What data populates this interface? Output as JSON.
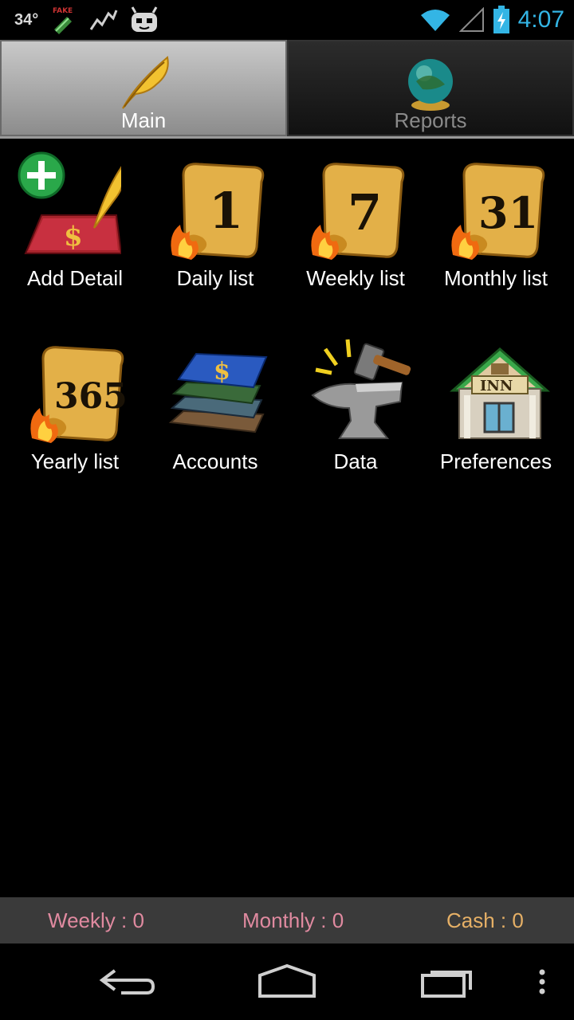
{
  "status_bar": {
    "temperature": "34°",
    "time": "4:07",
    "icons": [
      "fake-gps-icon",
      "activity-graph-icon",
      "android-icon",
      "wifi-icon",
      "signal-icon",
      "battery-charging-icon"
    ]
  },
  "tabs": [
    {
      "label": "Main",
      "icon": "quill-icon",
      "selected": true
    },
    {
      "label": "Reports",
      "icon": "globe-icon",
      "selected": false
    }
  ],
  "grid": [
    {
      "label": "Add Detail",
      "icon": "add-detail-icon"
    },
    {
      "label": "Daily list",
      "icon": "scroll-1-icon"
    },
    {
      "label": "Weekly list",
      "icon": "scroll-7-icon"
    },
    {
      "label": "Monthly list",
      "icon": "scroll-31-icon"
    },
    {
      "label": "Yearly list",
      "icon": "scroll-365-icon"
    },
    {
      "label": "Accounts",
      "icon": "books-icon"
    },
    {
      "label": "Data",
      "icon": "anvil-icon"
    },
    {
      "label": "Preferences",
      "icon": "inn-house-icon"
    }
  ],
  "summary": {
    "weekly": "Weekly : 0",
    "monthly": "Monthly : 0",
    "cash": "Cash : 0"
  },
  "nav": [
    "back-icon",
    "home-icon",
    "recent-apps-icon",
    "menu-icon"
  ],
  "colors": {
    "accent": "#33b5e5",
    "summary_pink": "#e08aa0",
    "summary_gold": "#e6b066"
  }
}
